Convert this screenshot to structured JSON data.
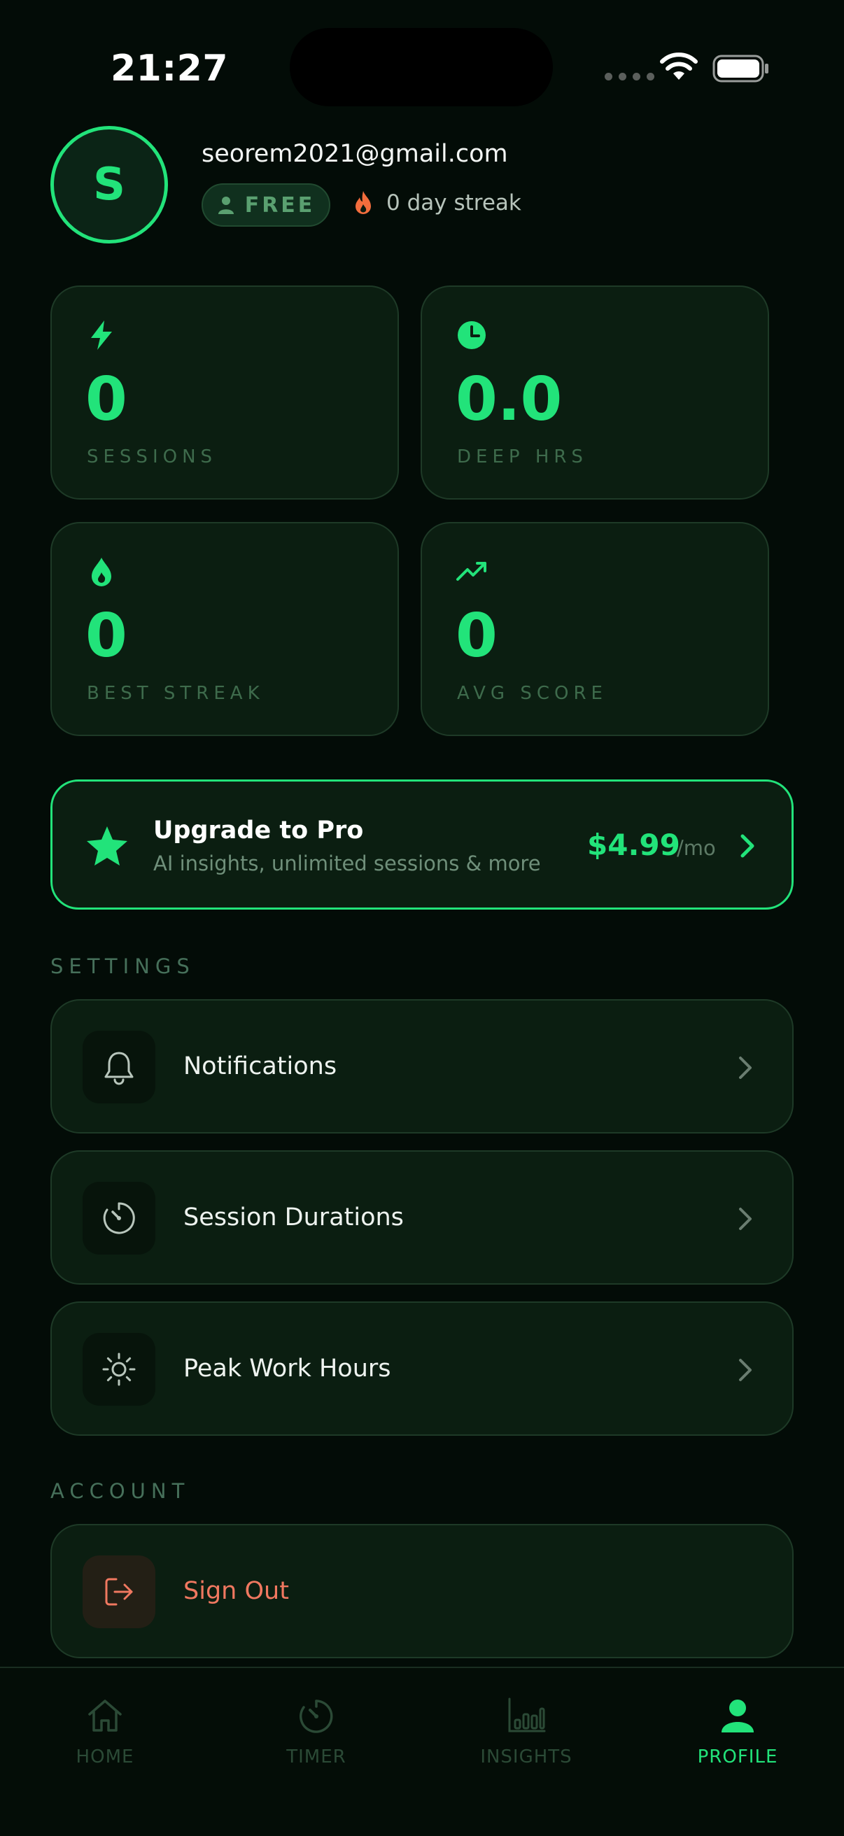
{
  "status_bar": {
    "time": "21:27"
  },
  "profile": {
    "avatar_initial": "S",
    "email": "seorem2021@gmail.com",
    "plan": "FREE",
    "streak_text": "0 day streak"
  },
  "stats": [
    {
      "icon": "lightning-icon",
      "value": "0",
      "label": "SESSIONS"
    },
    {
      "icon": "clock-icon",
      "value": "0.0",
      "label": "DEEP HRS"
    },
    {
      "icon": "drop-icon",
      "value": "0",
      "label": "BEST STREAK"
    },
    {
      "icon": "trend-up-icon",
      "value": "0",
      "label": "AVG SCORE"
    }
  ],
  "upgrade": {
    "title": "Upgrade to Pro",
    "subtitle": "AI insights, unlimited sessions & more",
    "price": "$4.99",
    "period": "/mo"
  },
  "sections": {
    "settings": "SETTINGS",
    "account": "ACCOUNT"
  },
  "settings_items": [
    {
      "icon": "bell-icon",
      "label": "Notifications"
    },
    {
      "icon": "timer-icon",
      "label": "Session Durations"
    },
    {
      "icon": "sun-icon",
      "label": "Peak Work Hours"
    }
  ],
  "account_items": [
    {
      "icon": "sign-out-icon",
      "label": "Sign Out"
    }
  ],
  "tabs": [
    {
      "icon": "home-icon",
      "label": "HOME",
      "active": false
    },
    {
      "icon": "timer-icon",
      "label": "TIMER",
      "active": false
    },
    {
      "icon": "bar-chart-icon",
      "label": "INSIGHTS",
      "active": false
    },
    {
      "icon": "person-icon",
      "label": "PROFILE",
      "active": true
    }
  ],
  "colors": {
    "accent": "#22e37a",
    "background": "#030c07",
    "card": "#0b1e11",
    "danger": "#f07860",
    "streak": "#f26d3d"
  }
}
